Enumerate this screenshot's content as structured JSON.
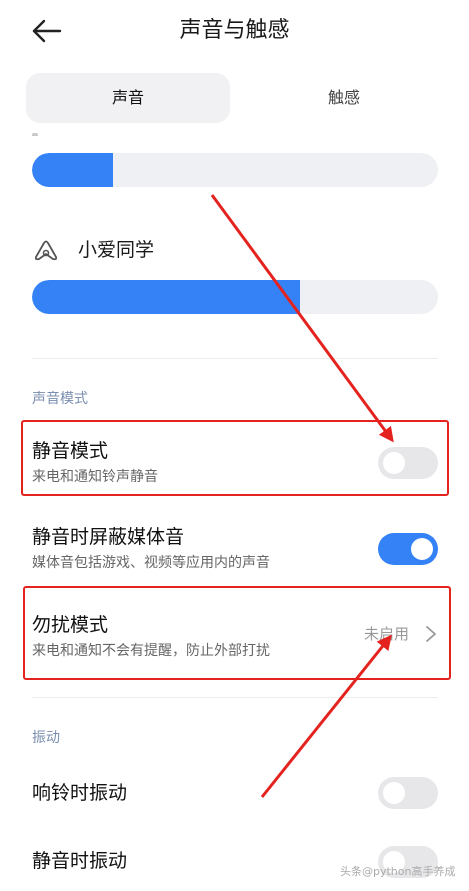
{
  "header": {
    "back_icon": "arrow-left-icon",
    "title": "声音与触感"
  },
  "tabs": [
    {
      "label": "声音",
      "active": true
    },
    {
      "label": "触感",
      "active": false
    }
  ],
  "volume": {
    "media_level": 0.2,
    "xiaoai_label": "小爱同学",
    "xiaoai_icon": "xiaoai-icon",
    "xiaoai_level": 0.66
  },
  "sections": {
    "sound_mode": {
      "header": "声音模式",
      "silent_mode": {
        "title": "静音模式",
        "desc": "来电和通知铃声静音",
        "enabled": false
      },
      "mute_media": {
        "title": "静音时屏蔽媒体音",
        "desc": "媒体音包括游戏、视频等应用内的声音",
        "enabled": true
      },
      "dnd": {
        "title": "勿扰模式",
        "desc": "来电和通知不会有提醒，防止外部打扰",
        "status": "未启用"
      }
    },
    "vibration": {
      "header": "振动",
      "ring_vibrate": {
        "title": "响铃时振动",
        "enabled": false
      },
      "silent_vibrate": {
        "title": "静音时振动",
        "enabled": false
      }
    }
  },
  "watermark": "头条@python高手养成",
  "colors": {
    "accent": "#3482f6",
    "annotation": "#e4231f",
    "section_header": "#7a8eb0"
  }
}
